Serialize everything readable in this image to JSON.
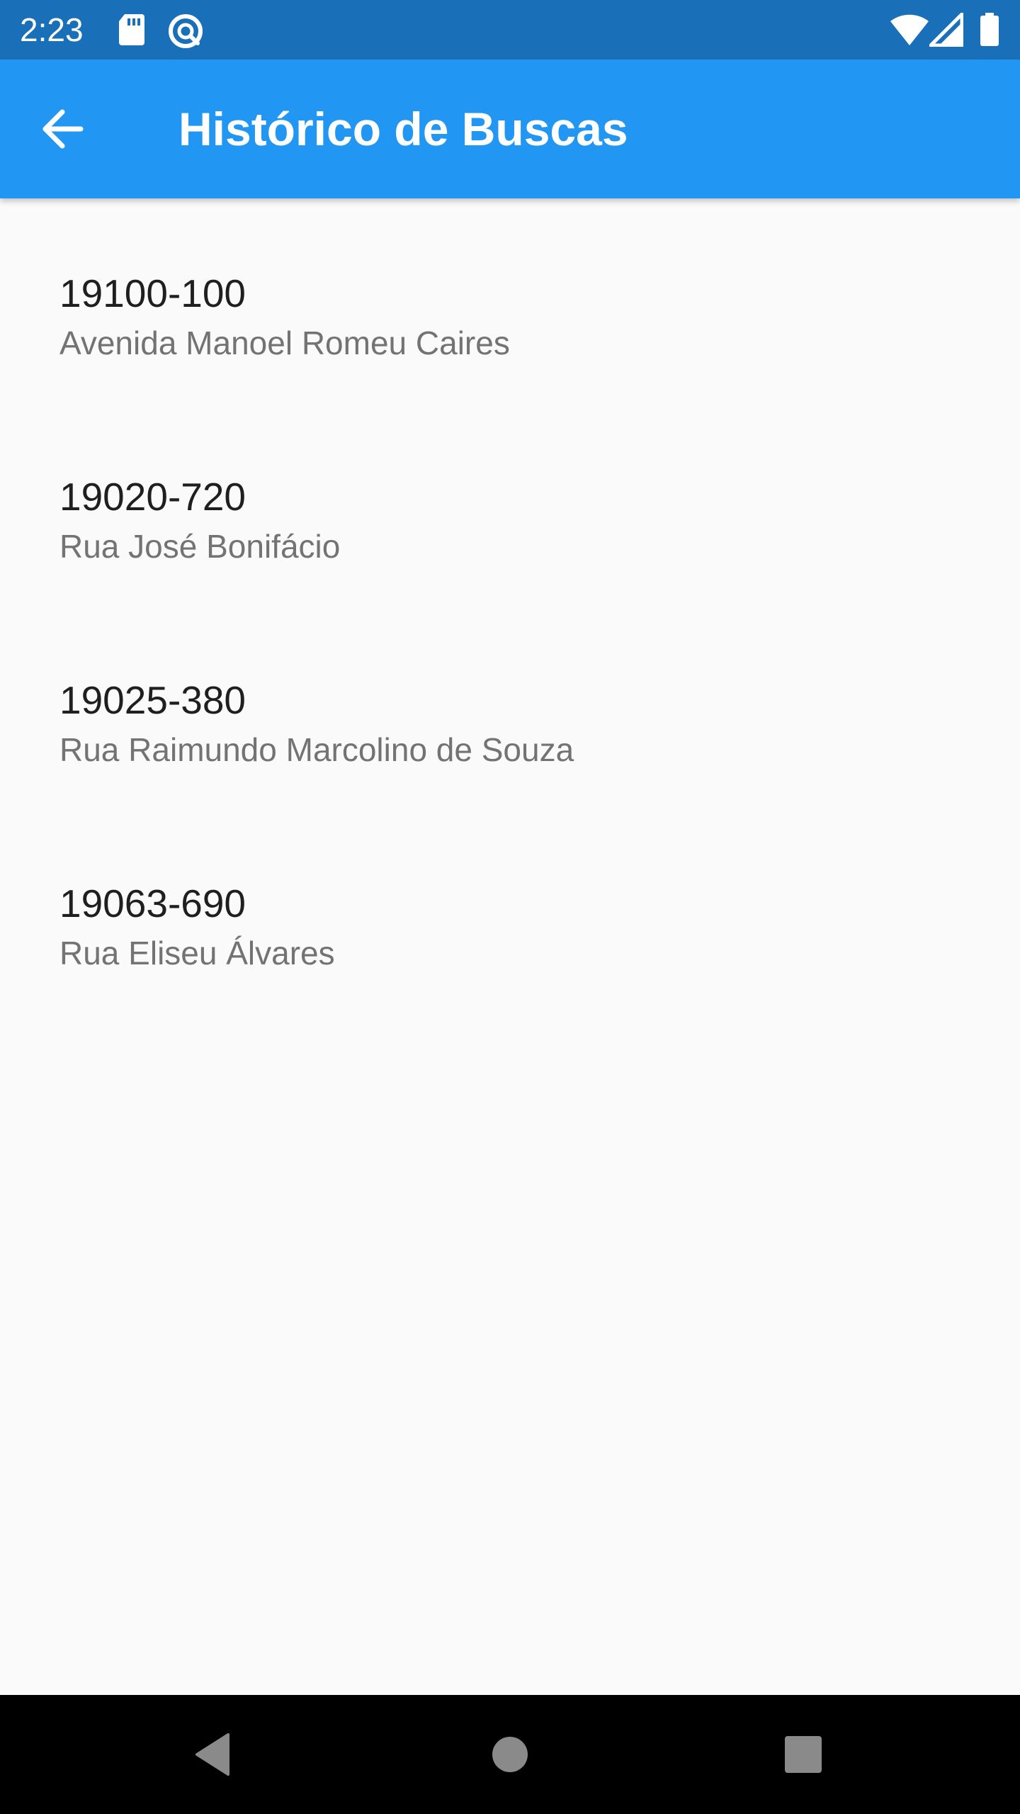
{
  "status_bar": {
    "time": "2:23",
    "icons": [
      "sd-card-icon",
      "sync-icon",
      "wifi-icon",
      "signal-icon",
      "battery-icon"
    ],
    "background": "#1a70b8"
  },
  "app_bar": {
    "title": "Histórico de Buscas",
    "back_icon": "arrow-back-icon",
    "background": "#2196f3"
  },
  "history": [
    {
      "cep": "19100-100",
      "street": "Avenida Manoel Romeu Caires"
    },
    {
      "cep": "19020-720",
      "street": "Rua José Bonifácio"
    },
    {
      "cep": "19025-380",
      "street": "Rua Raimundo Marcolino de Souza"
    },
    {
      "cep": "19063-690",
      "street": "Rua Eliseu Álvares"
    }
  ],
  "nav_bar": {
    "buttons": [
      "back-triangle-icon",
      "home-circle-icon",
      "recents-square-icon"
    ],
    "background": "#000000"
  }
}
